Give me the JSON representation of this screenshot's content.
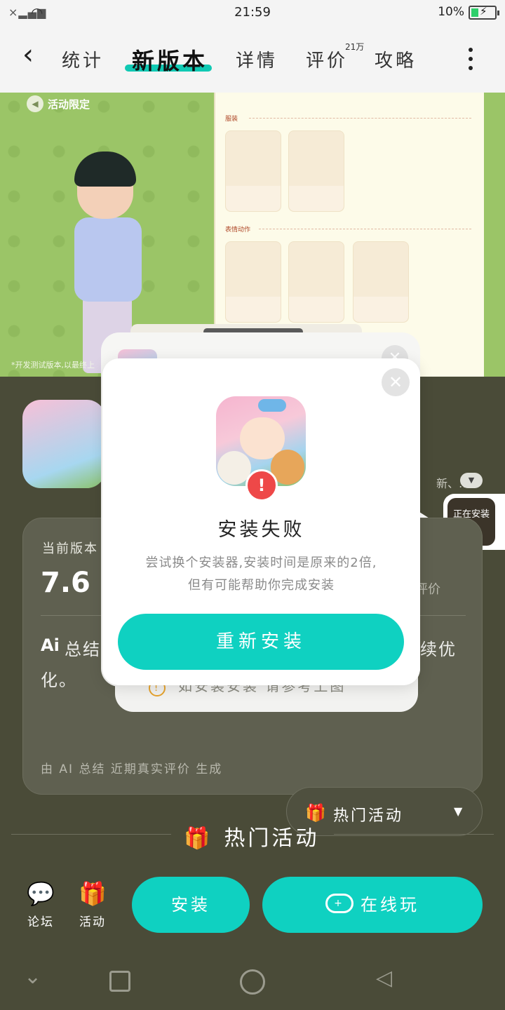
{
  "status_bar": {
    "time": "21:59",
    "battery": "10%"
  },
  "nav": {
    "tabs": [
      {
        "label": "统计"
      },
      {
        "label": "新版本"
      },
      {
        "label": "详情"
      },
      {
        "label": "评价"
      },
      {
        "label": "攻略"
      }
    ],
    "review_badge": "21万"
  },
  "banner": {
    "limit_label": "活动限定",
    "panel_section_1": "服装",
    "panel_section_2": "表情动作",
    "dev_note": "*开发测试版本,以最终上"
  },
  "version_card": {
    "label": "当前版本",
    "number": "7.6",
    "review_tag": "评价",
    "side_tag": "新、…",
    "summary": "总结 房屋装修的 ;但近期更新 底反馈仍需持续优化。",
    "note": "由 AI 总结 近期真实评价 生成",
    "warning": "如安装安装 请参考上图"
  },
  "floating": {
    "installing_label": "正在安装"
  },
  "hot_activity": {
    "label": "热门活动"
  },
  "bottom_bar": {
    "forum": "论坛",
    "activity": "活动",
    "install": "安装",
    "online": "在线玩"
  },
  "dialog": {
    "title": "安装失败",
    "desc_line1": "尝试换个安装器,安装时间是原来的2倍,",
    "desc_line2": "但有可能帮助你完成安装",
    "retry": "重新安装"
  },
  "colors": {
    "accent": "#0fd1c1",
    "error": "#ee4848",
    "dark_bg": "#4a4b38"
  }
}
